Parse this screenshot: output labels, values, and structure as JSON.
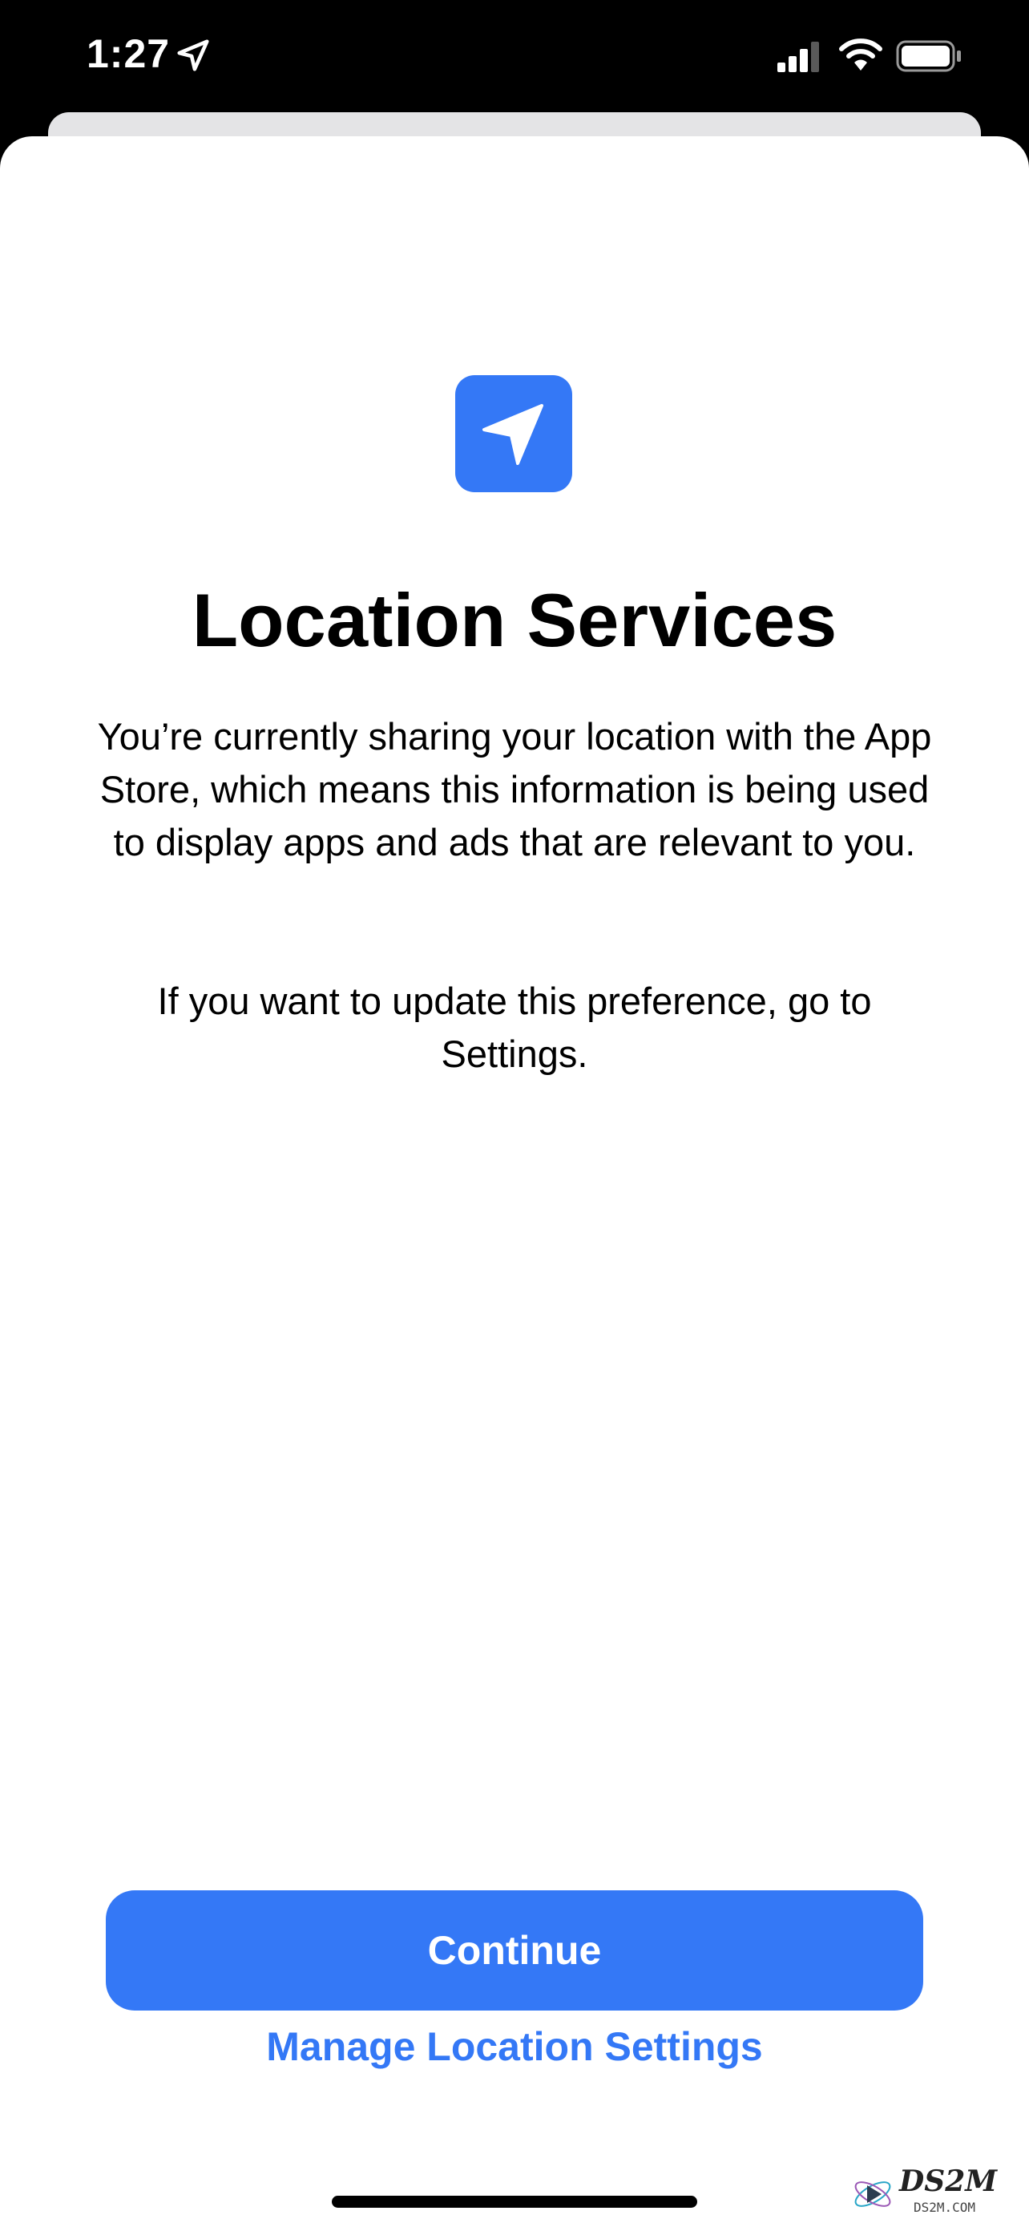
{
  "status_bar": {
    "time": "1:27",
    "icons": [
      "location-arrow-icon",
      "cellular-signal-icon",
      "wifi-icon",
      "battery-icon"
    ]
  },
  "sheet": {
    "icon": "location-arrow-icon",
    "icon_color": "#3478f6",
    "title": "Location Services",
    "paragraph_1": "You’re currently sharing your location with the App Store, which means this information is being used to display apps and ads that are relevant to you.",
    "paragraph_2": "If you want to update this preference, go to Settings.",
    "continue_label": "Continue",
    "manage_label": "Manage Location Settings",
    "accent_color": "#3478f6"
  },
  "watermark": {
    "brand": "DS2M",
    "sub": "DS2M.COM"
  }
}
